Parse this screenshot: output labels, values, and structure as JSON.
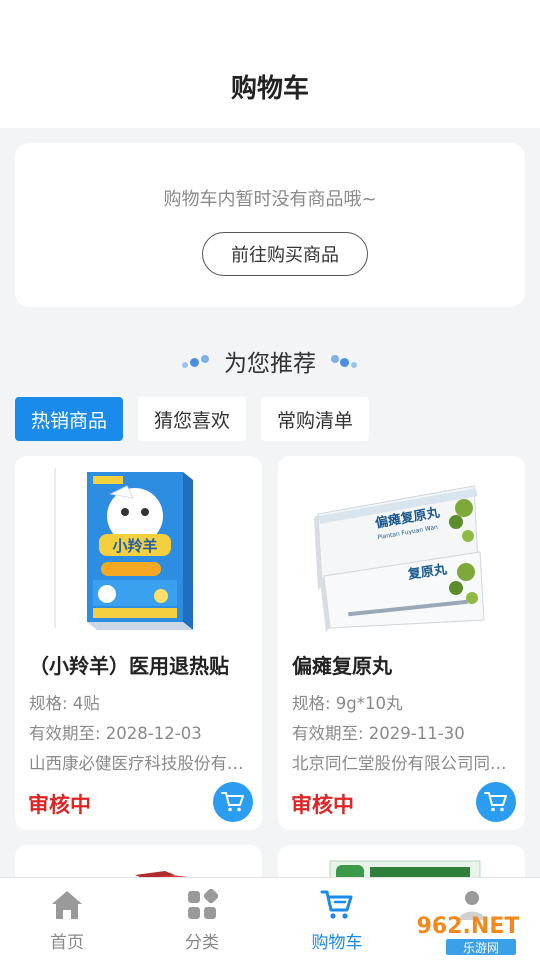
{
  "header": {
    "title": "购物车"
  },
  "empty_cart": {
    "message": "购物车内暂时没有商品哦~",
    "button_label": "前往购买商品"
  },
  "recommend": {
    "title": "为您推荐"
  },
  "tabs": [
    {
      "label": "热销商品",
      "active": true
    },
    {
      "label": "猜您喜欢",
      "active": false
    },
    {
      "label": "常购清单",
      "active": false
    }
  ],
  "products": [
    {
      "name": "（小羚羊）医用退热贴",
      "spec": "规格: 4贴",
      "expiry": "有效期至: 2028-12-03",
      "manufacturer": "山西康必健医疗科技股份有限公司",
      "status": "审核中",
      "image_icon": "product-box-xiaolingyang-icon",
      "box_text": "小羚羊"
    },
    {
      "name": "偏瘫复原丸",
      "spec": "规格: 9g*10丸",
      "expiry": "有效期至: 2029-11-30",
      "manufacturer": "北京同仁堂股份有限公司同仁堂制药厂",
      "status": "审核中",
      "image_icon": "product-box-piantan-icon",
      "box_text": "偏瘫复原丸",
      "box_subtext": "Piantan Fuyuan Wan"
    }
  ],
  "tabbar": [
    {
      "label": "首页",
      "icon": "home-icon",
      "active": false
    },
    {
      "label": "分类",
      "icon": "category-icon",
      "active": false
    },
    {
      "label": "购物车",
      "icon": "cart-icon",
      "active": true
    },
    {
      "label": "",
      "icon": "user-icon",
      "active": false
    }
  ],
  "watermark": {
    "text": "962.NET",
    "subtext": "乐游网"
  },
  "colors": {
    "accent": "#1a8bea",
    "status": "#e02424",
    "cart_button": "#2a9df0",
    "background": "#f3f4f6"
  }
}
